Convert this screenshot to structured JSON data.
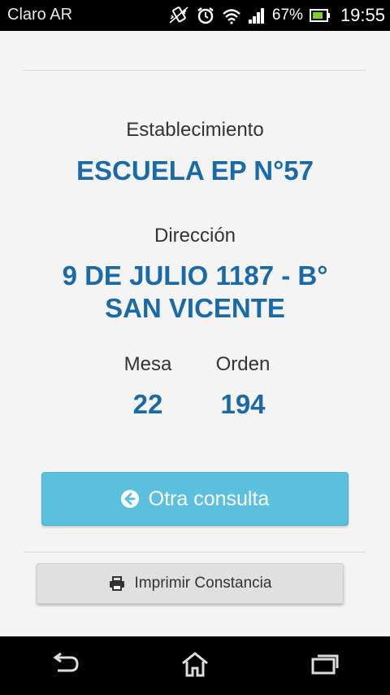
{
  "status_bar": {
    "carrier": "Claro AR",
    "battery_percent": "67%",
    "time": "19:55",
    "icons": [
      "vibrate-icon",
      "alarm-icon",
      "wifi-icon",
      "signal-icon",
      "battery-icon"
    ]
  },
  "result": {
    "establecimiento_label": "Establecimiento",
    "establecimiento_value": "ESCUELA EP N°57",
    "direccion_label": "Dirección",
    "direccion_line1": "9 DE JULIO 1187 - B°",
    "direccion_line2": "SAN VICENTE",
    "mesa_label": "Mesa",
    "mesa_value": "22",
    "orden_label": "Orden",
    "orden_value": "194"
  },
  "actions": {
    "otra_consulta_label": "Otra consulta",
    "otra_consulta_icon": "arrow-circle-left-icon",
    "imprimir_label": "Imprimir Constancia",
    "imprimir_icon": "printer-icon"
  },
  "colors": {
    "accent_text": "#1a6aa8",
    "primary_button": "#5bc0de",
    "secondary_button": "#e0e0e0"
  },
  "nav_bar": {
    "icons": [
      "back-icon",
      "home-icon",
      "recent-apps-icon"
    ]
  }
}
